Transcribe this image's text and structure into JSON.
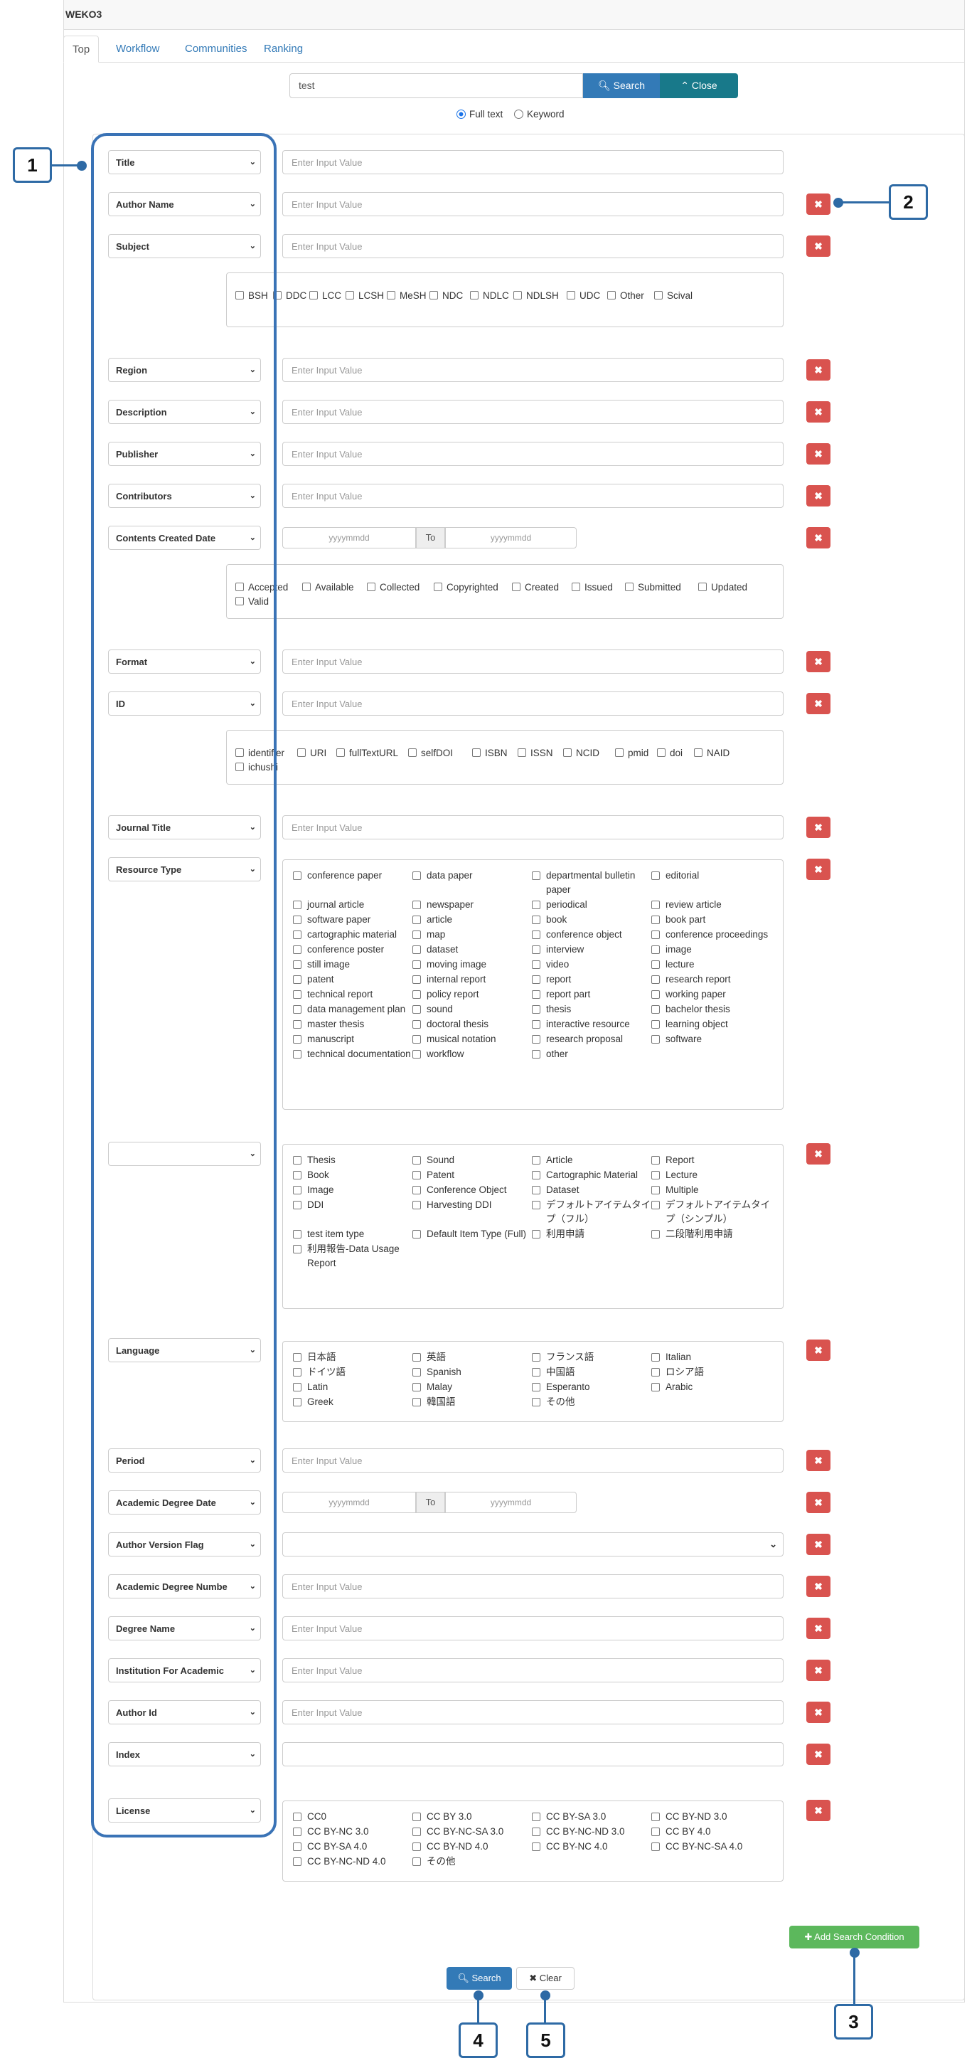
{
  "app": {
    "brand": "WEKO3"
  },
  "tabs": [
    "Top",
    "Workflow",
    "Communities",
    "Ranking"
  ],
  "search": {
    "query": "test",
    "search_label": "Search",
    "close_label": "Close",
    "modes": [
      "Full text",
      "Keyword"
    ],
    "selected_mode": "Full text"
  },
  "placeholder": "Enter Input Value",
  "date_placeholder": "yyyymmdd",
  "date_to": "To",
  "delete_icon": "✖",
  "rows": [
    {
      "label": "Title"
    },
    {
      "label": "Author Name"
    },
    {
      "label": "Subject"
    },
    {
      "label": "Region"
    },
    {
      "label": "Description"
    },
    {
      "label": "Publisher"
    },
    {
      "label": "Contributors"
    },
    {
      "label": "Contents Created Date"
    },
    {
      "label": "Format"
    },
    {
      "label": "ID"
    },
    {
      "label": "Journal Title"
    },
    {
      "label": "Resource Type"
    },
    {
      "label": ""
    },
    {
      "label": "Language"
    },
    {
      "label": "Period"
    },
    {
      "label": "Academic Degree Date"
    },
    {
      "label": "Author Version Flag"
    },
    {
      "label": "Academic Degree Numbe"
    },
    {
      "label": "Degree Name"
    },
    {
      "label": "Institution For Academic"
    },
    {
      "label": "Author Id"
    },
    {
      "label": "Index"
    },
    {
      "label": "License"
    }
  ],
  "subject_schemes": [
    "BSH",
    "DDC",
    "LCC",
    "LCSH",
    "MeSH",
    "NDC",
    "NDLC",
    "NDLSH",
    "UDC",
    "Other",
    "Scival"
  ],
  "date_types": [
    "Accepted",
    "Available",
    "Collected",
    "Copyrighted",
    "Created",
    "Issued",
    "Submitted",
    "Updated",
    "Valid"
  ],
  "id_types": [
    "identifier",
    "URI",
    "fullTextURL",
    "selfDOI",
    "ISBN",
    "ISSN",
    "NCID",
    "pmid",
    "doi",
    "NAID",
    "ichushi"
  ],
  "resource_types": [
    "conference paper",
    "data paper",
    "departmental bulletin paper",
    "editorial",
    "journal article",
    "newspaper",
    "periodical",
    "review article",
    "software paper",
    "article",
    "book",
    "book part",
    "cartographic material",
    "map",
    "conference object",
    "conference proceedings",
    "conference poster",
    "dataset",
    "interview",
    "image",
    "still image",
    "moving image",
    "video",
    "lecture",
    "patent",
    "internal report",
    "report",
    "research report",
    "technical report",
    "policy report",
    "report part",
    "working paper",
    "data management plan",
    "sound",
    "thesis",
    "bachelor thesis",
    "master thesis",
    "doctoral thesis",
    "interactive resource",
    "learning object",
    "manuscript",
    "musical notation",
    "research proposal",
    "software",
    "technical documentation",
    "workflow",
    "other"
  ],
  "item_types": [
    "Thesis",
    "Sound",
    "Article",
    "Report",
    "Book",
    "Patent",
    "Cartographic Material",
    "Lecture",
    "Image",
    "Conference Object",
    "Dataset",
    "Multiple",
    "DDI",
    "Harvesting DDI",
    "デフォルトアイテムタイプ（フル）",
    "デフォルトアイテムタイプ（シンプル）",
    "test item type",
    "Default Item Type (Full)",
    "利用申請",
    "二段階利用申請",
    "利用報告-Data Usage Report"
  ],
  "languages": [
    "日本語",
    "英語",
    "フランス語",
    "Italian",
    "ドイツ語",
    "Spanish",
    "中国語",
    "ロシア語",
    "Latin",
    "Malay",
    "Esperanto",
    "Arabic",
    "Greek",
    "韓国語",
    "その他"
  ],
  "licenses": [
    "CC0",
    "CC BY 3.0",
    "CC BY-SA 3.0",
    "CC BY-ND 3.0",
    "CC BY-NC 3.0",
    "CC BY-NC-SA 3.0",
    "CC BY-NC-ND 3.0",
    "CC BY 4.0",
    "CC BY-SA 4.0",
    "CC BY-ND 4.0",
    "CC BY-NC 4.0",
    "CC BY-NC-SA 4.0",
    "CC BY-NC-ND 4.0",
    "その他"
  ],
  "buttons": {
    "add_condition": "Add Search Condition",
    "search": "Search",
    "clear": "Clear"
  },
  "callouts": [
    "1",
    "2",
    "3",
    "4",
    "5"
  ],
  "colors": {
    "primary": "#337ab7",
    "danger": "#d9534f",
    "success": "#5cb85c",
    "callout": "#2e6aa5"
  }
}
